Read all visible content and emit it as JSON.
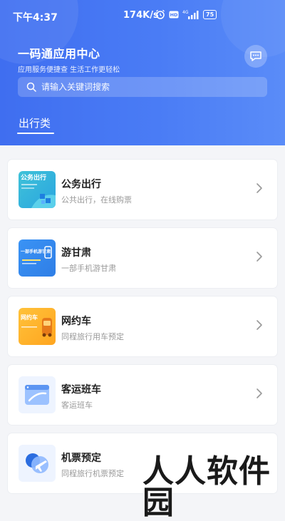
{
  "status_bar": {
    "time": "下午4:37",
    "speed": "174K/s",
    "battery": "75"
  },
  "header": {
    "title": "一码通应用中心",
    "subtitle": "应用服务便捷查  生活工作更轻松"
  },
  "search": {
    "placeholder": "请输入关键词搜索"
  },
  "tabs": [
    {
      "label": "出行类"
    }
  ],
  "services": [
    {
      "name": "公务出行",
      "desc": "公共出行，在线购票",
      "thumb_label": "公务出行",
      "icon": "official-travel-icon"
    },
    {
      "name": "游甘肃",
      "desc": "一部手机游甘肃",
      "thumb_label": "一部手机游甘肃",
      "icon": "gansu-travel-icon"
    },
    {
      "name": "网约车",
      "desc": "同程旅行用车预定",
      "thumb_label": "网约车",
      "icon": "ride-hailing-icon"
    },
    {
      "name": "客运班车",
      "desc": "客运班车",
      "thumb_label": "",
      "icon": "bus-ticket-icon"
    },
    {
      "name": "机票预定",
      "desc": "同程旅行机票预定",
      "thumb_label": "",
      "icon": "flight-booking-icon"
    }
  ],
  "watermark": "人人软件园",
  "colors": {
    "header_blue": "#4a7cf5",
    "card_bg": "#ffffff",
    "page_bg": "#f4f5f8"
  }
}
